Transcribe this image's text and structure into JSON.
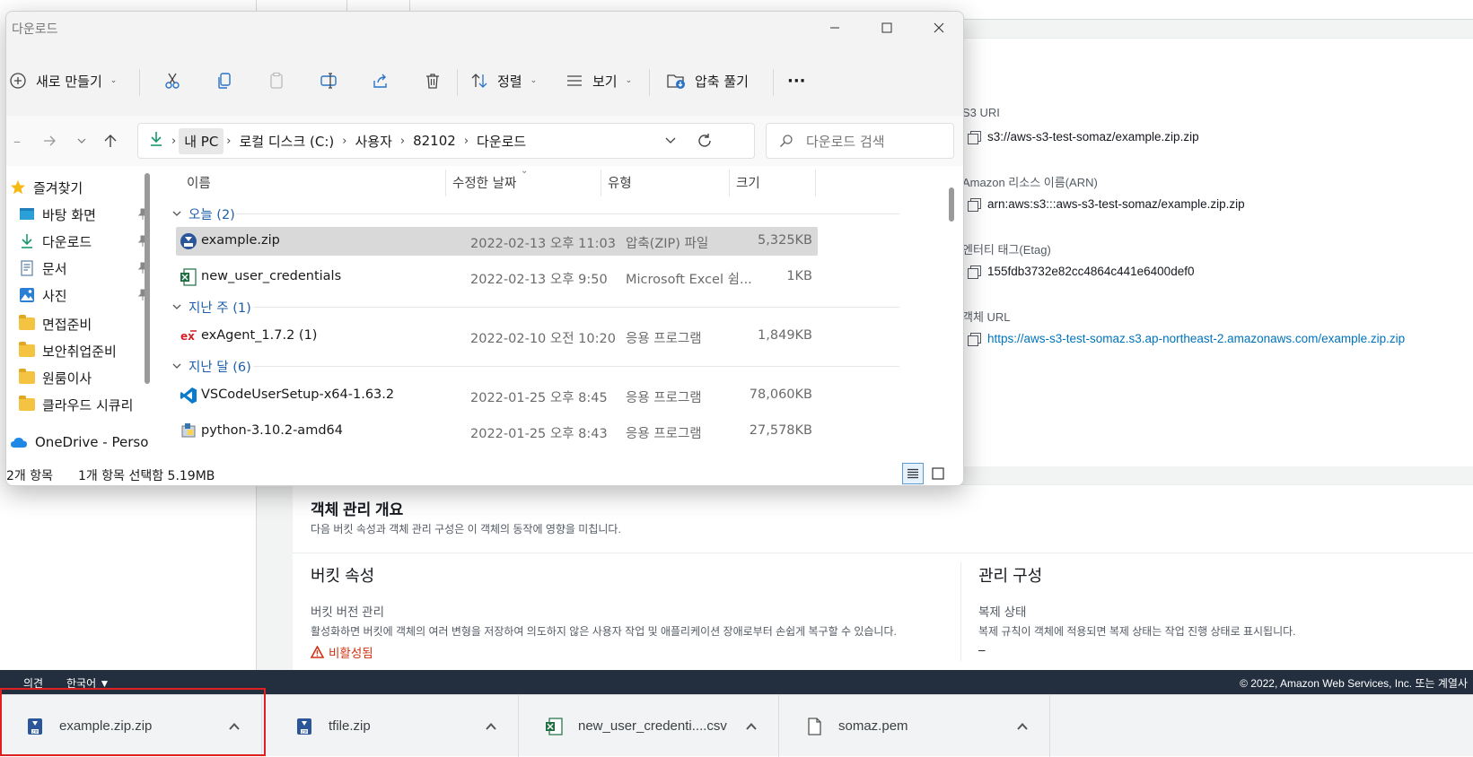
{
  "aws": {
    "properties": [
      {
        "label": "S3 URI",
        "value": "s3://aws-s3-test-somaz/example.zip.zip",
        "link": false
      },
      {
        "label": "Amazon 리소스 이름(ARN)",
        "value": "arn:aws:s3:::aws-s3-test-somaz/example.zip.zip",
        "link": false
      },
      {
        "label": "엔터티 태그(Etag)",
        "value": "155fdb3732e82cc4864c441e6400def0",
        "link": false
      },
      {
        "label": "객체 URL",
        "value": "https://aws-s3-test-somaz.s3.ap-northeast-2.amazonaws.com/example.zip.zip",
        "link": true
      }
    ],
    "mgmt": {
      "title": "객체 관리 개요",
      "desc": "다음 버킷 속성과 객체 관리 구성은 이 객체의 동작에 영향을 미칩니다.",
      "bucket_props_title": "버킷 속성",
      "versioning_label": "버킷 버전 관리",
      "versioning_desc": "활성화하면 버킷에 객체의 여러 변형을 저장하여 의도하지 않은 사용자 작업 및 애플리케이션 장애로부터 손쉽게 복구할 수 있습니다.",
      "versioning_status": "비활성됨",
      "mgmt_config_title": "관리 구성",
      "replication_label": "복제 상태",
      "replication_desc": "복제 규칙이 객체에 적용되면 복제 상태는 작업 진행 상태로 표시됩니다.",
      "replication_value": "–"
    },
    "footer": {
      "feedback": "의견",
      "language": "한국어 ▼",
      "copyright": "© 2022, Amazon Web Services, Inc. 또는 계열사"
    }
  },
  "downloads": [
    {
      "name": "example.zip.zip",
      "icon": "zip-icon"
    },
    {
      "name": "tfile.zip",
      "icon": "zip-icon"
    },
    {
      "name": "new_user_credenti....csv",
      "icon": "excel-icon"
    },
    {
      "name": "somaz.pem",
      "icon": "file-icon"
    }
  ],
  "explorer": {
    "title": "다운로드",
    "toolbar": {
      "new": "새로 만들기",
      "sort": "정렬",
      "view": "보기",
      "extract": "압축 풀기",
      "more": "···"
    },
    "address": {
      "crumbs": [
        "내 PC",
        "로컬 디스크 (C:)",
        "사용자",
        "82102",
        "다운로드"
      ],
      "search_placeholder": "다운로드 검색"
    },
    "sidebar": {
      "favorites": "즐겨찾기",
      "items": [
        "바탕 화면",
        "다운로드",
        "문서",
        "사진",
        "면접준비",
        "보안취업준비",
        "원룸이사",
        "클라우드 시큐리"
      ],
      "onedrive": "OneDrive - Perso"
    },
    "columns": {
      "name": "이름",
      "date": "수정한 날짜",
      "type": "유형",
      "size": "크기"
    },
    "groups": [
      {
        "label": "오늘 (2)",
        "files": [
          {
            "name": "example.zip",
            "date": "2022-02-13 오후 11:03",
            "type": "압축(ZIP) 파일",
            "size": "5,325KB",
            "icon": "zip-icon",
            "selected": true
          },
          {
            "name": "new_user_credentials",
            "date": "2022-02-13 오후 9:50",
            "type": "Microsoft Excel 쉼...",
            "size": "1KB",
            "icon": "excel-icon",
            "selected": false
          }
        ]
      },
      {
        "label": "지난 주 (1)",
        "files": [
          {
            "name": "exAgent_1.7.2 (1)",
            "date": "2022-02-10 오전 10:20",
            "type": "응용 프로그램",
            "size": "1,849KB",
            "icon": "exagent-icon",
            "selected": false
          }
        ]
      },
      {
        "label": "지난 달 (6)",
        "files": [
          {
            "name": "VSCodeUserSetup-x64-1.63.2",
            "date": "2022-01-25 오후 8:45",
            "type": "응용 프로그램",
            "size": "78,060KB",
            "icon": "vscode-icon",
            "selected": false
          },
          {
            "name": "python-3.10.2-amd64",
            "date": "2022-01-25 오후 8:43",
            "type": "응용 프로그램",
            "size": "27,578KB",
            "icon": "python-installer-icon",
            "selected": false
          }
        ]
      }
    ],
    "status": {
      "count": "2개 항목",
      "selected": "1개 항목 선택함 5.19MB"
    }
  },
  "colors": {
    "aws_link": "#0073bb",
    "aws_footer": "#232f3e",
    "highlight": "#e02020",
    "disabled": "#d13212"
  }
}
